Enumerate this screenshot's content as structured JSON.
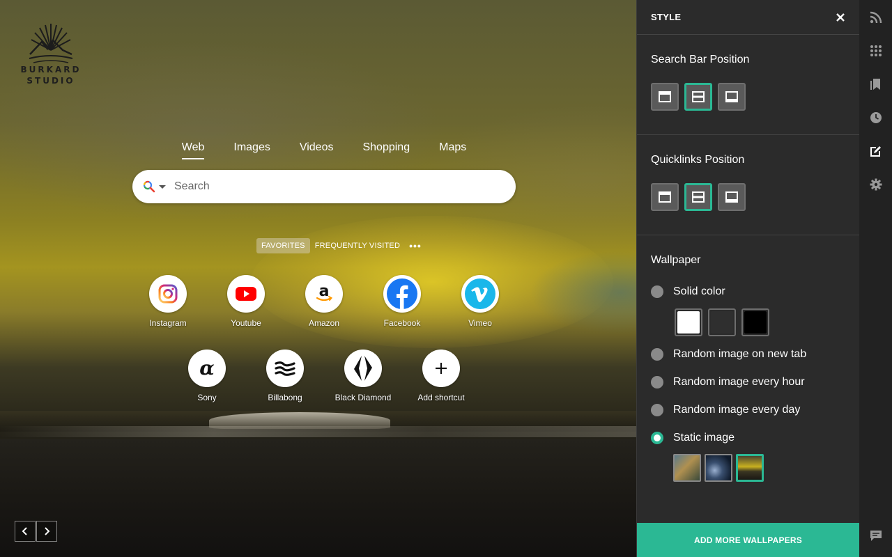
{
  "logo": {
    "line1": "BURKARD",
    "line2": "STUDIO"
  },
  "search": {
    "tabs": [
      {
        "label": "Web",
        "active": true
      },
      {
        "label": "Images",
        "active": false
      },
      {
        "label": "Videos",
        "active": false
      },
      {
        "label": "Shopping",
        "active": false
      },
      {
        "label": "Maps",
        "active": false
      }
    ],
    "placeholder": "Search",
    "value": ""
  },
  "quicklinks": {
    "tabs": [
      {
        "label": "FAVORITES",
        "active": true
      },
      {
        "label": "FREQUENTLY VISITED",
        "active": false
      }
    ],
    "more": "•••",
    "items": [
      {
        "name": "Instagram",
        "icon": "instagram-icon"
      },
      {
        "name": "Youtube",
        "icon": "youtube-icon"
      },
      {
        "name": "Amazon",
        "icon": "amazon-icon"
      },
      {
        "name": "Facebook",
        "icon": "facebook-icon"
      },
      {
        "name": "Vimeo",
        "icon": "vimeo-icon"
      },
      {
        "name": "Sony",
        "icon": "sony-alpha-icon"
      },
      {
        "name": "Billabong",
        "icon": "billabong-icon"
      },
      {
        "name": "Black Diamond",
        "icon": "black-diamond-icon"
      },
      {
        "name": "Add shortcut",
        "icon": "plus-icon"
      }
    ]
  },
  "panel": {
    "title": "STYLE",
    "search_bar_position": {
      "title": "Search Bar Position",
      "selected": "middle"
    },
    "quicklinks_position": {
      "title": "Quicklinks Position",
      "selected": "middle"
    },
    "wallpaper": {
      "title": "Wallpaper",
      "options": [
        {
          "label": "Solid color",
          "selected": false
        },
        {
          "label": "Random image on new tab",
          "selected": false
        },
        {
          "label": "Random image every hour",
          "selected": false
        },
        {
          "label": "Random image every day",
          "selected": false
        },
        {
          "label": "Static image",
          "selected": true
        }
      ],
      "solid_colors": [
        "#ffffff",
        "#2f2f2f",
        "#000000"
      ],
      "selected_thumbnail": 3
    },
    "add_button": "ADD MORE WALLPAPERS"
  },
  "colors": {
    "accent": "#2bb894",
    "panel_bg": "#2b2b2b",
    "iconbar_bg": "#222222"
  }
}
